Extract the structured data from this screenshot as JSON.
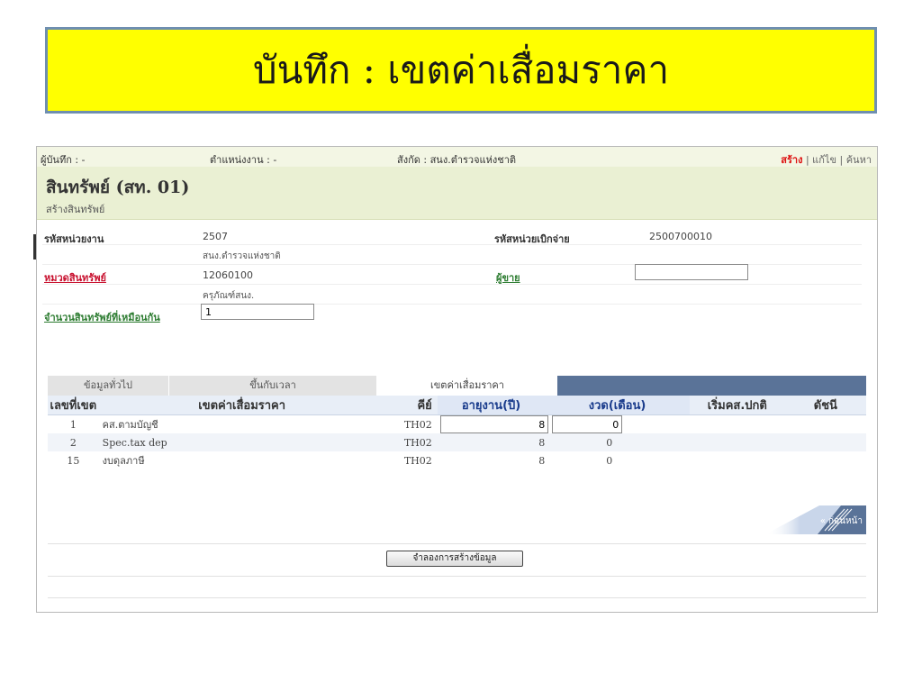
{
  "slide": {
    "title": "บันทึก : เขตค่าเสื่อมราคา"
  },
  "topbar": {
    "recorder": "ผู้บันทึก : -",
    "position": "ตำแหน่งงาน : -",
    "affiliation": "สังกัด : สนง.ตำรวจแห่งชาติ",
    "actions": {
      "create": "สร้าง",
      "sep1": "|",
      "edit": "แก้ไข",
      "sep2": "|",
      "search": "ค้นหา"
    }
  },
  "header": {
    "title": "สินทรัพย์ (สท. 01)",
    "subtitle": "สร้างสินทรัพย์"
  },
  "form": {
    "unit_code_label": "รหัสหน่วยงาน",
    "unit_code": "2507",
    "unit_name": "สนง.ตำรวจแห่งชาติ",
    "disburse_code_label": "รหัสหน่วยเบิกจ่าย",
    "disburse_code": "2500700010",
    "category_label": "หมวดสินทรัพย์",
    "category_code": "12060100",
    "category_name": "ครุภัณฑ์สนง.",
    "vendor_label": "ผู้ขาย",
    "vendor_value": "",
    "same_count_label": "จำนวนสินทรัพย์ที่เหมือนกัน",
    "same_count_value": "1"
  },
  "tabs": [
    {
      "label": "ข้อมูลทั่วไป",
      "active": false
    },
    {
      "label": "ขึ้นกับเวลา",
      "active": false
    },
    {
      "label": "เขตค่าเสื่อมราคา",
      "active": true
    }
  ],
  "table": {
    "headers": [
      "เลขที่เขต",
      "เขตค่าเสื่อมราคา",
      "คีย์",
      "อายุงาน(ปี)",
      "งวด(เดือน)",
      "เริ่มคส.ปกติ",
      "ดัชนี"
    ],
    "rows": [
      {
        "no": "1",
        "name": "คส.ตามบัญชี",
        "key": "TH02",
        "life": "8",
        "period": "0",
        "start": "",
        "index": ""
      },
      {
        "no": "2",
        "name": "Spec.tax dep",
        "key": "TH02",
        "life": "8",
        "period": "0",
        "start": "",
        "index": ""
      },
      {
        "no": "15",
        "name": "งบดุลภาษี",
        "key": "TH02",
        "life": "8",
        "period": "0",
        "start": "",
        "index": ""
      }
    ]
  },
  "buttons": {
    "back": "« ก่อนหน้า",
    "simulate": "จำลองการสร้างข้อมูล"
  },
  "colors": {
    "slide_title_bg": "#ffff00",
    "header_bg": "#eaf0d3",
    "tab_bar": "#5a7398",
    "link_red": "#c8102e",
    "link_green": "#2e7d32"
  }
}
